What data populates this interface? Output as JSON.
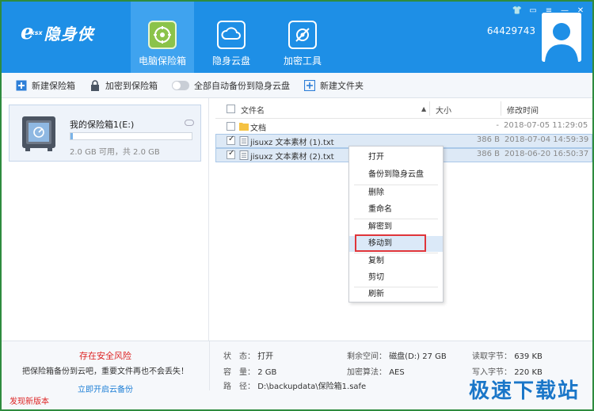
{
  "header": {
    "logo_letter": "e",
    "logo_sub": "xsx",
    "logo_name": "隐身侠",
    "tabs": [
      {
        "label": "电脑保险箱",
        "icon": "safe-icon",
        "active": true
      },
      {
        "label": "隐身云盘",
        "icon": "cloud-icon",
        "active": false
      },
      {
        "label": "加密工具",
        "icon": "tools-icon",
        "active": false
      }
    ],
    "user_id": "64429743",
    "window_controls": [
      "shirt-icon",
      "message-icon",
      "menu-icon",
      "minimize-icon",
      "close-icon"
    ]
  },
  "toolbar": {
    "new_vault": "新建保险箱",
    "encrypt_to_vault": "加密到保险箱",
    "auto_backup": "全部自动备份到隐身云盘",
    "new_folder": "新建文件夹"
  },
  "vault": {
    "name": "我的保险箱1(E:)",
    "capacity": "2.0 GB 可用，共 2.0 GB",
    "used_fraction": 0.02
  },
  "file_list": {
    "headers": {
      "name": "文件名",
      "size": "大小",
      "modified": "修改时间"
    },
    "rows": [
      {
        "name": "文档",
        "size": "-",
        "date": "2018-07-05 11:29:05",
        "type": "folder",
        "checked": false,
        "selected": false
      },
      {
        "name": "jisuxz 文本素材 (1).txt",
        "size": "386 B",
        "date": "2018-07-04 14:59:39",
        "type": "txt",
        "checked": true,
        "selected": true
      },
      {
        "name": "jisuxz 文本素材 (2).txt",
        "size": "386 B",
        "date": "2018-06-20 16:50:37",
        "type": "txt",
        "checked": true,
        "selected": true
      }
    ]
  },
  "context_menu": {
    "items": [
      "打开",
      "备份到隐身云盘",
      "删除",
      "重命名",
      "解密到",
      "移动到",
      "复制",
      "剪切",
      "刷新"
    ],
    "highlighted": "移动到"
  },
  "bottom": {
    "risk_title": "存在安全风险",
    "risk_desc": "把保险箱备份到云吧，重要文件再也不会丢失！",
    "enable_backup": "立即开启云备份",
    "new_version": "发现新版本",
    "status_label": "状　态：",
    "status_value": "打开",
    "capacity_label": "容　量：",
    "capacity_value": "2 GB",
    "path_label": "路　径：",
    "path_value": "D:\\backupdata\\保险箱1.safe",
    "free_label": "剩余空间：",
    "free_value": "磁盘(D:) 27 GB",
    "algo_label": "加密算法：",
    "algo_value": "AES",
    "read_label": "读取字节：",
    "read_value": "639 KB",
    "write_label": "写入字节：",
    "write_value": "220 KB",
    "watermark": "极速下载站"
  },
  "colors": {
    "header_blue": "#1e8fe6",
    "highlight_red": "#e0353a",
    "risk_red": "#dd2222",
    "link_blue": "#1e7fd6"
  }
}
